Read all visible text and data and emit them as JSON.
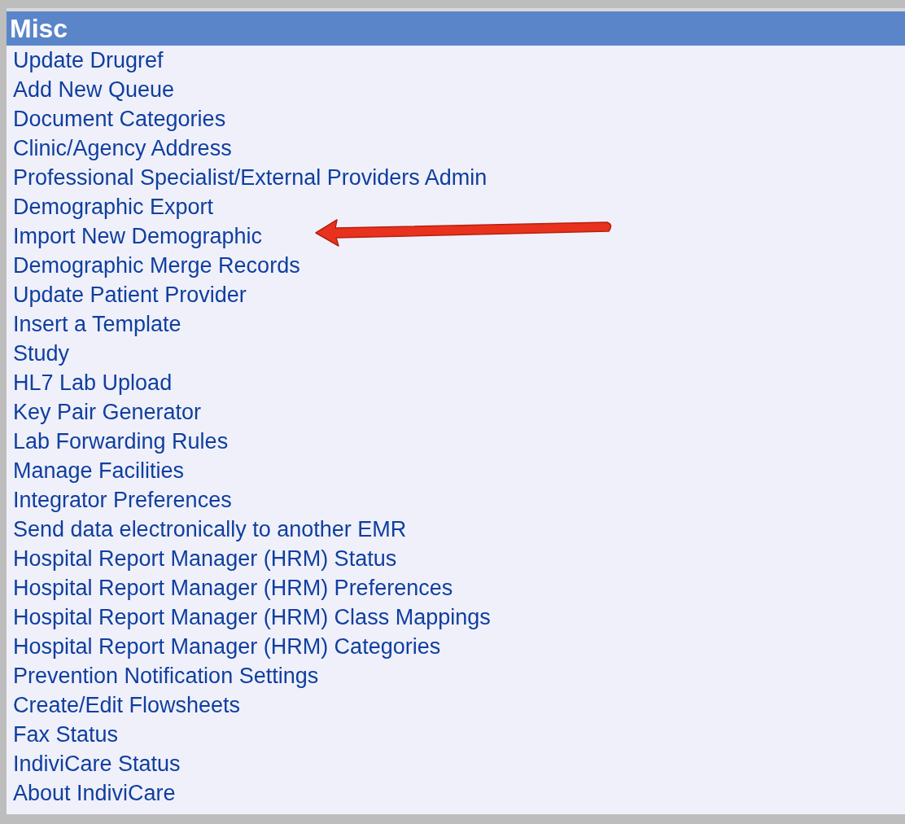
{
  "panel": {
    "title": "Misc",
    "items": [
      "Update Drugref",
      "Add New Queue",
      "Document Categories",
      "Clinic/Agency Address",
      "Professional Specialist/External Providers Admin",
      "Demographic Export",
      "Import New Demographic",
      "Demographic Merge Records",
      "Update Patient Provider",
      "Insert a Template",
      "Study",
      "HL7 Lab Upload",
      "Key Pair Generator",
      "Lab Forwarding Rules",
      "Manage Facilities",
      "Integrator Preferences",
      "Send data electronically to another EMR",
      "Hospital Report Manager (HRM) Status",
      "Hospital Report Manager (HRM) Preferences",
      "Hospital Report Manager (HRM) Class Mappings",
      "Hospital Report Manager (HRM) Categories",
      "Prevention Notification Settings",
      "Create/Edit Flowsheets",
      "Fax Status",
      "IndiviCare Status",
      "About IndiviCare"
    ]
  }
}
